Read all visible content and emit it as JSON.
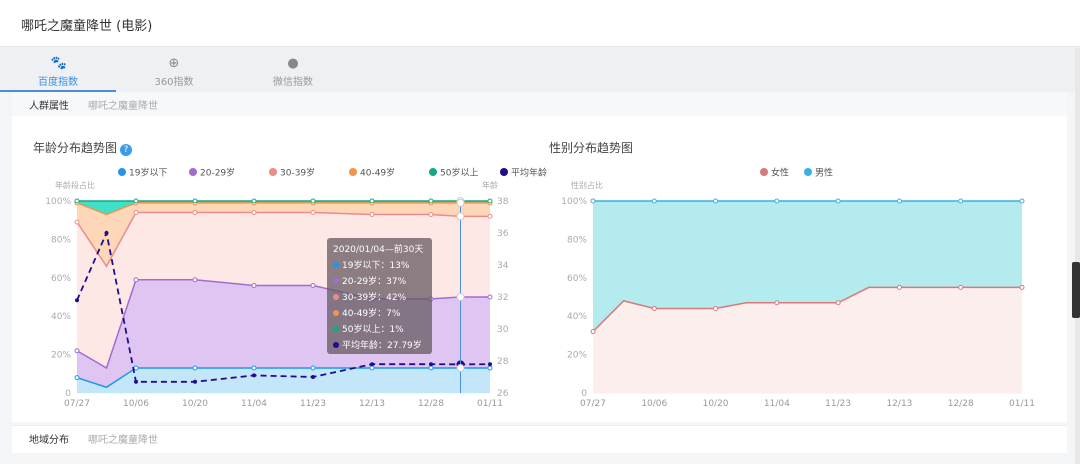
{
  "header": {
    "title": "哪吒之魔童降世 (电影)"
  },
  "tabs": [
    {
      "label": "百度指数",
      "icon": "paw-icon"
    },
    {
      "label": "360指数",
      "icon": "plus-circle-icon"
    },
    {
      "label": "微信指数",
      "icon": "wechat-icon"
    }
  ],
  "section1": {
    "label": "人群属性",
    "sub": "哪吒之魔童降世"
  },
  "section2": {
    "label": "地域分布",
    "sub": "哪吒之魔童降世"
  },
  "chart_data": [
    {
      "type": "area",
      "title": "年龄分布趋势图",
      "ylabel": "年龄段占比",
      "y2label": "年龄",
      "stacked": true,
      "categories": [
        "07/27",
        "10/06",
        "10/20",
        "11/04",
        "11/23",
        "12/13",
        "12/28",
        "01/11"
      ],
      "x": [
        0,
        0.5,
        1,
        2,
        3,
        4,
        5,
        6,
        6.5,
        7
      ],
      "yticks": [
        "0",
        "20%",
        "40%",
        "60%",
        "80%",
        "100%"
      ],
      "ylim": [
        0,
        100
      ],
      "y2ticks": [
        "26",
        "28",
        "30",
        "32",
        "34",
        "36",
        "38"
      ],
      "y2lim": [
        26,
        38
      ],
      "series": [
        {
          "name": "19岁以下",
          "color": "#2196e8",
          "fill": "#c3e6f8",
          "values": [
            8,
            3,
            13,
            13,
            13,
            13,
            13,
            13,
            13,
            13
          ]
        },
        {
          "name": "20-29岁",
          "color": "#a46bd0",
          "fill": "#dfc6f2",
          "values": [
            14,
            10,
            46,
            46,
            43,
            43,
            36,
            36,
            37,
            37
          ]
        },
        {
          "name": "30-39岁",
          "color": "#e98c8c",
          "fill": "#fde8e6",
          "values": [
            67,
            53,
            35,
            35,
            38,
            38,
            44,
            44,
            42,
            42
          ]
        },
        {
          "name": "40-49岁",
          "color": "#f0964a",
          "fill": "#fdd7b8",
          "values": [
            10,
            27,
            5,
            5,
            5,
            5,
            6,
            6,
            7,
            7
          ]
        },
        {
          "name": "50岁以上",
          "color": "#14a883",
          "fill": "#3ee0c8",
          "values": [
            1,
            7,
            1,
            1,
            1,
            1,
            1,
            1,
            1,
            1
          ]
        },
        {
          "name": "平均年龄",
          "color": "#1e0e8c",
          "axis": "right",
          "dashed": true,
          "values": [
            31.8,
            36,
            26.7,
            26.7,
            27.1,
            27.0,
            27.8,
            27.8,
            27.79,
            27.8
          ]
        }
      ],
      "tooltip": {
        "title": "2020/01/04—前30天",
        "rows": [
          "19岁以下：13%",
          "20-29岁：37%",
          "30-39岁：42%",
          "40-49岁：7%",
          "50岁以上：1%",
          "平均年龄：27.79岁"
        ]
      }
    },
    {
      "type": "area",
      "title": "性别分布趋势图",
      "ylabel": "性别占比",
      "stacked": true,
      "categories": [
        "07/27",
        "10/06",
        "10/20",
        "11/04",
        "11/23",
        "12/13",
        "12/28",
        "01/11"
      ],
      "x": [
        0,
        0.5,
        1,
        2,
        2.5,
        3,
        4,
        4.5,
        5,
        6,
        7
      ],
      "yticks": [
        "0",
        "20%",
        "40%",
        "60%",
        "80%",
        "100%"
      ],
      "ylim": [
        0,
        100
      ],
      "series": [
        {
          "name": "女性",
          "color": "#d87a7a",
          "fill": "#fdeeee",
          "values": [
            32,
            48,
            44,
            44,
            47,
            47,
            47,
            55,
            55,
            55,
            55
          ]
        },
        {
          "name": "男性",
          "color": "#3bb0e8",
          "fill": "#b3ebee",
          "values": [
            68,
            52,
            56,
            56,
            53,
            53,
            53,
            45,
            45,
            45,
            45
          ]
        }
      ]
    }
  ]
}
